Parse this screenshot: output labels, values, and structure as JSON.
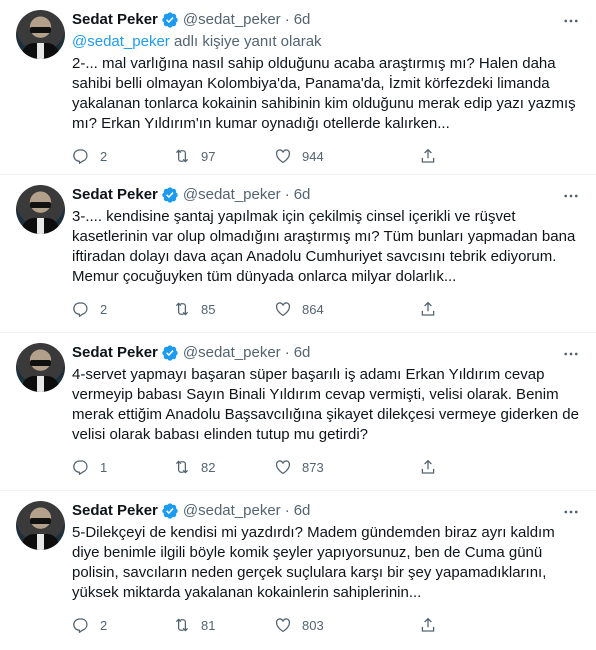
{
  "colors": {
    "accent": "#1d9bf0",
    "secondary_text": "#536471",
    "primary_text": "#0f1419",
    "divider": "#eff3f4"
  },
  "icons": {
    "verified": "verified-badge-icon",
    "more": "more-options-icon",
    "reply": "reply-icon",
    "retweet": "retweet-icon",
    "like": "heart-icon",
    "share": "share-icon"
  },
  "tweets": [
    {
      "name": "Sedat Peker",
      "handle": "@sedat_peker",
      "dot": "·",
      "time": "6d",
      "reply_to_prefix": "@sedat_peker",
      "reply_to_suffix": " adlı kişiye yanıt olarak",
      "text": "2-... mal varlığına nasıl sahip olduğunu acaba araştırmış mı? Halen daha sahibi belli olmayan Kolombiya'da, Panama'da, İzmit körfezdeki limanda yakalanan tonlarca kokainin sahibinin kim olduğunu merak edip yazı yazmış mı? Erkan Yıldırım'ın kumar oynadığı otellerde kalırken...",
      "replies": "2",
      "retweets": "97",
      "likes": "944"
    },
    {
      "name": "Sedat Peker",
      "handle": "@sedat_peker",
      "dot": "·",
      "time": "6d",
      "text": "3-.... kendisine şantaj yapılmak için çekilmiş cinsel içerikli ve rüşvet kasetlerinin var olup olmadığını araştırmış mı? Tüm bunları yapmadan bana iftiradan dolayı dava açan Anadolu Cumhuriyet savcısını tebrik ediyorum. Memur çocuğuyken tüm dünyada onlarca milyar dolarlık...",
      "replies": "2",
      "retweets": "85",
      "likes": "864"
    },
    {
      "name": "Sedat Peker",
      "handle": "@sedat_peker",
      "dot": "·",
      "time": "6d",
      "text": "4-servet yapmayı başaran süper başarılı iş adamı Erkan Yıldırım cevap vermeyip babası Sayın Binali Yıldırım cevap vermişti, velisi olarak. Benim merak ettiğim Anadolu Başsavcılığına şikayet dilekçesi vermeye giderken de velisi olarak babası elinden tutup mu getirdi?",
      "replies": "1",
      "retweets": "82",
      "likes": "873"
    },
    {
      "name": "Sedat Peker",
      "handle": "@sedat_peker",
      "dot": "·",
      "time": "6d",
      "text": "5-Dilekçeyi de kendisi mi yazdırdı? Madem gündemden biraz ayrı kaldım diye benimle ilgili böyle komik şeyler yapıyorsunuz, ben de Cuma günü polisin, savcıların neden gerçek suçlulara karşı bir şey yapamadıklarını, yüksek miktarda yakalanan kokainlerin sahiplerinin...",
      "replies": "2",
      "retweets": "81",
      "likes": "803"
    }
  ]
}
